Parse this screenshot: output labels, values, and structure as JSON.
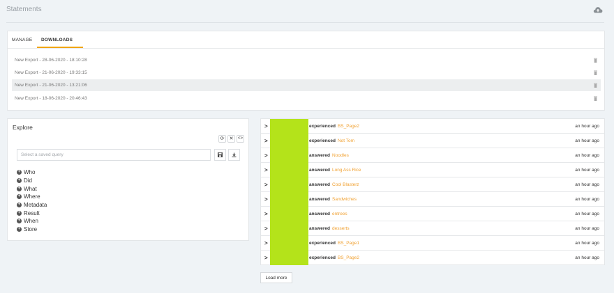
{
  "page": {
    "title": "Statements"
  },
  "icons": {
    "upload": "cloud-upload-icon",
    "trash": "trash-icon",
    "refresh": "refresh-icon",
    "clear": "close-icon",
    "code": "code-icon",
    "save": "save-icon",
    "download": "download-icon",
    "add": "plus-circle-icon",
    "expand": "chevron-right-icon"
  },
  "tabs": [
    {
      "label": "MANAGE",
      "active": false
    },
    {
      "label": "DOWNLOADS",
      "active": true
    }
  ],
  "exports": [
    {
      "label": "New Export - 28-06-2020 - 18:10:28"
    },
    {
      "label": "New Export - 21-06-2020 - 19:33:15"
    },
    {
      "label": "New Export - 21-06-2020 - 13:21:06"
    },
    {
      "label": "New Export - 18-06-2020 - 20:46:43"
    }
  ],
  "explore": {
    "title": "Explore",
    "query_placeholder": "Select a saved query",
    "refresh_glyph": "⟳",
    "clear_glyph": "✕",
    "code_glyph": "<>",
    "filters": [
      "Who",
      "Did",
      "What",
      "Where",
      "Metadata",
      "Result",
      "When",
      "Store"
    ]
  },
  "statements": [
    {
      "verb": "experienced",
      "object": "BS_Page2",
      "time": "an hour ago"
    },
    {
      "verb": "experienced",
      "object": "Not Tom",
      "time": "an hour ago"
    },
    {
      "verb": "answered",
      "object": "Noodles",
      "time": "an hour ago"
    },
    {
      "verb": "answered",
      "object": "Long Ass Rice",
      "time": "an hour ago"
    },
    {
      "verb": "answered",
      "object": "Cool Blasterz",
      "time": "an hour ago"
    },
    {
      "verb": "answered",
      "object": "Sandwiches",
      "time": "an hour ago"
    },
    {
      "verb": "answered",
      "object": "entrees",
      "time": "an hour ago"
    },
    {
      "verb": "answered",
      "object": "desserts",
      "time": "an hour ago"
    },
    {
      "verb": "experienced",
      "object": "BS_Page1",
      "time": "an hour ago"
    },
    {
      "verb": "experienced",
      "object": "BS_Page2",
      "time": "an hour ago"
    }
  ],
  "load_more_label": "Load more",
  "colors": {
    "accent": "#f0a500",
    "actor": "#b4e31a",
    "object_link": "#f0a030",
    "background": "#eff3f6"
  }
}
